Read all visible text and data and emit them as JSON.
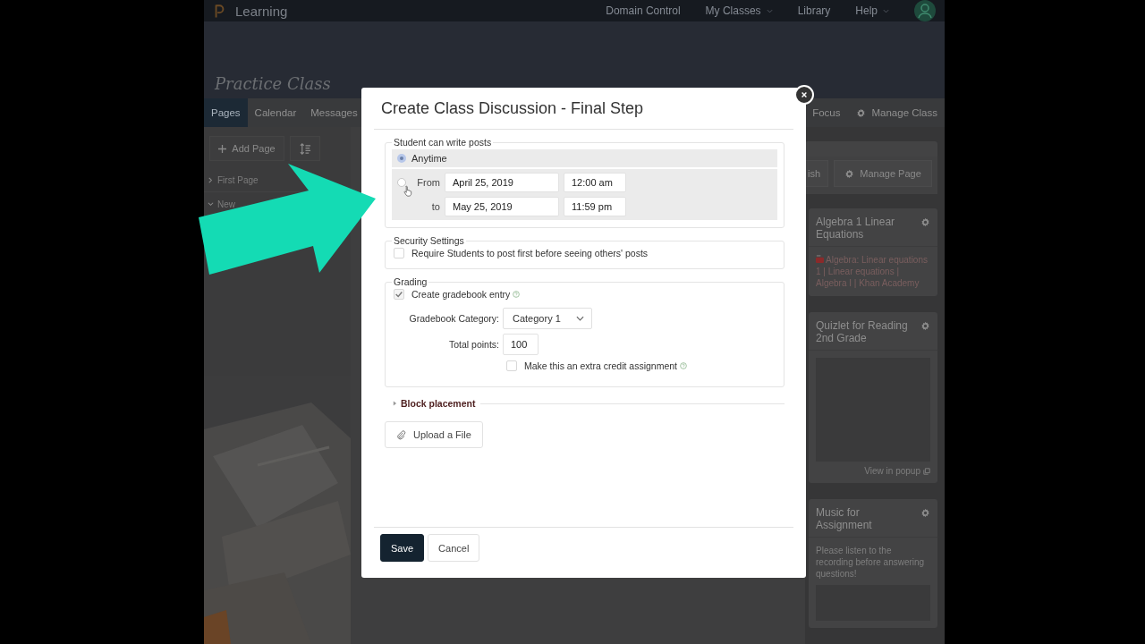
{
  "top_nav": {
    "brand": "Learning",
    "links": [
      {
        "label": "Domain Control",
        "dropdown": false
      },
      {
        "label": "My Classes",
        "dropdown": true
      },
      {
        "label": "Library",
        "dropdown": false
      },
      {
        "label": "Help",
        "dropdown": true
      }
    ]
  },
  "class_title": "Practice Class",
  "tabs": [
    {
      "label": "Pages",
      "selected": true
    },
    {
      "label": "Calendar",
      "selected": false
    },
    {
      "label": "Messages",
      "selected": false
    }
  ],
  "right_tabs": [
    {
      "label": "Focus",
      "kind": "text"
    },
    {
      "label": "Manage Class",
      "kind": "gear"
    }
  ],
  "sidebar": {
    "add_button": "Add Page",
    "items": [
      {
        "label": "First Page",
        "expanded": false
      },
      {
        "label": "New",
        "expanded": true
      }
    ]
  },
  "page_actions": [
    {
      "label": "ish",
      "kind": "text"
    },
    {
      "label": "Manage Page",
      "kind": "gear"
    }
  ],
  "widgets": [
    {
      "kind": "video",
      "title": "Algebra 1 Linear Equations",
      "text": "Algebra: Linear equations 1 | Linear equations | Algebra I | Khan Academy"
    },
    {
      "kind": "embed",
      "title": "Quizlet for Reading 2nd Grade",
      "link": "View in popup"
    },
    {
      "kind": "audio",
      "title": "Music for Assignment",
      "text": "Please listen to the recording before answering questions!"
    }
  ],
  "dialog": {
    "title": "Create Class Discussion - Final Step",
    "posting": {
      "legend": "Student can write posts",
      "options": [
        {
          "kind": "simple",
          "label": "Anytime",
          "selected": true
        },
        {
          "kind": "range",
          "label": "From",
          "selected": false,
          "from_date": "April 25, 2019",
          "from_time": "12:00 am",
          "to_label": "to",
          "to_date": "May 25, 2019",
          "to_time": "11:59 pm"
        }
      ]
    },
    "security": {
      "legend": "Security Settings",
      "checkbox": {
        "label": "Require Students to post first before seeing others' posts",
        "checked": false
      }
    },
    "grading": {
      "legend": "Grading",
      "create_entry": {
        "label": "Create gradebook entry",
        "checked": true,
        "help": true
      },
      "category_label": "Gradebook Category:",
      "category": "Category 1",
      "points_label": "Total points:",
      "points": "100",
      "extra_credit": {
        "label": "Make this an extra credit assignment",
        "checked": false,
        "help": true
      }
    },
    "block_placement": {
      "label": "Block placement",
      "expanded": false
    },
    "upload_button": "Upload a File",
    "buttons": [
      {
        "label": "Save",
        "primary": true
      },
      {
        "label": "Cancel",
        "primary": false
      }
    ]
  }
}
